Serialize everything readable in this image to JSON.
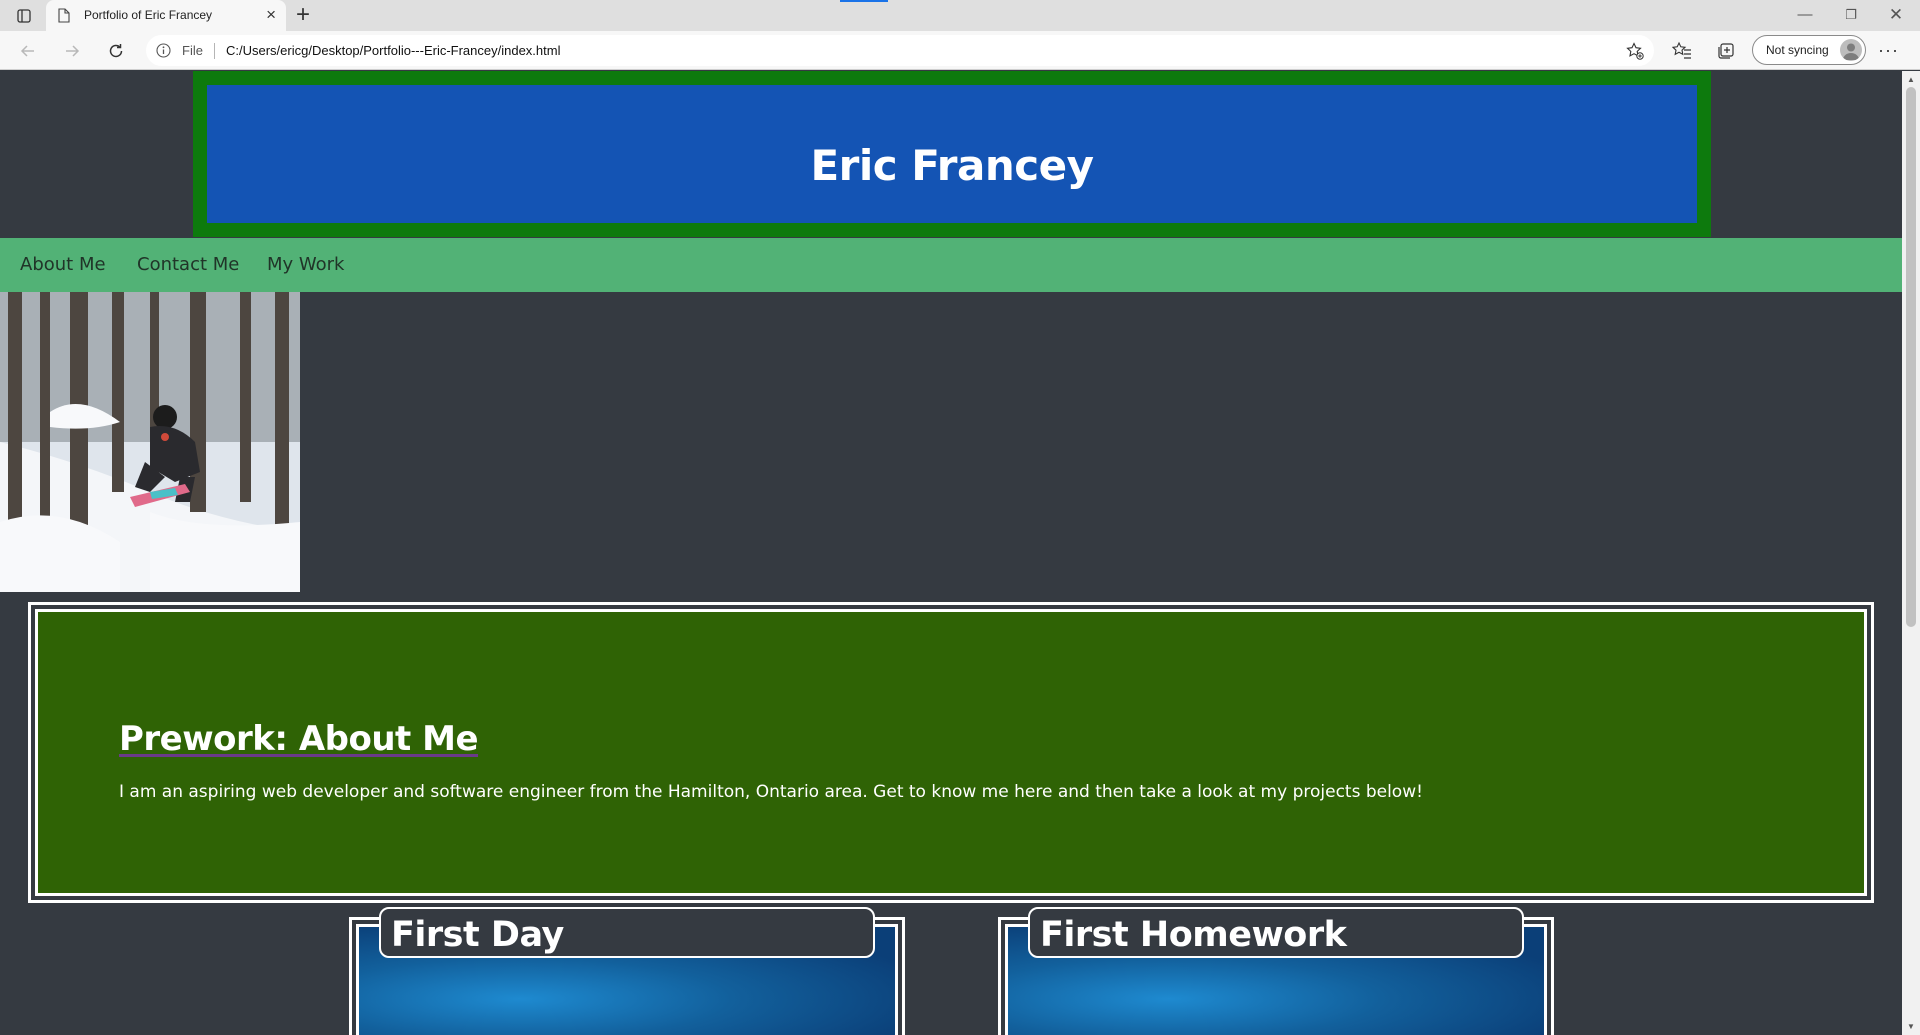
{
  "browser": {
    "tab_title": "Portfolio of Eric Francey",
    "address_prefix": "File",
    "url": "C:/Users/ericg/Desktop/Portfolio---Eric-Francey/index.html",
    "sync_label": "Not syncing"
  },
  "header": {
    "title": "Eric Francey"
  },
  "nav": {
    "items": [
      {
        "label": "About Me"
      },
      {
        "label": "Contact Me"
      },
      {
        "label": "My Work"
      }
    ]
  },
  "about": {
    "title": "Prework: About Me",
    "text": "I am an aspiring web developer and software engineer from the Hamilton, Ontario area. Get to know me here and then take a look at my projects below!"
  },
  "projects": [
    {
      "title": "First Day"
    },
    {
      "title": "First Homework"
    }
  ],
  "colors": {
    "page_bg": "#353a41",
    "header_blue": "#1454b4",
    "header_border": "#0d7a0d",
    "nav_green": "#52b276",
    "about_green": "#2f6305"
  }
}
